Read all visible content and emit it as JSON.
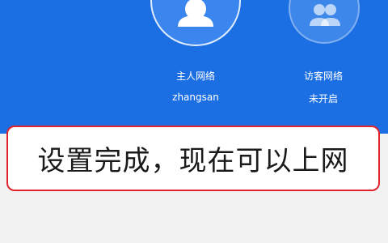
{
  "header": {
    "background": "#1c6fe3"
  },
  "networks": [
    {
      "name": "主人网络",
      "status": "zhangsan",
      "icon": "user-icon"
    },
    {
      "name": "访客网络",
      "status": "未开启",
      "icon": "users-icon"
    }
  ],
  "banner": {
    "text": "设置完成，现在可以上网",
    "border_color": "#e0242c"
  }
}
